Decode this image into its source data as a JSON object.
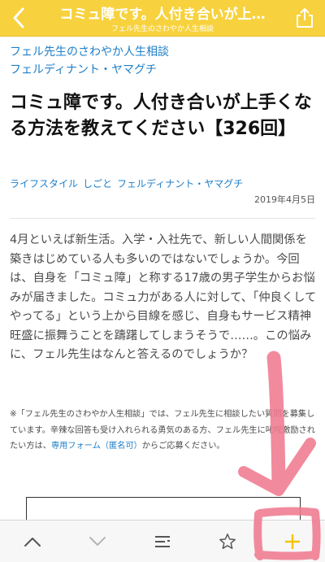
{
  "nav": {
    "title": "コミュ障です。人付き合いが上…",
    "subtitle": "フェル先生のさわやか人生相談",
    "back_icon": "chevron-left-icon",
    "share_icon": "share-icon",
    "bar_color": "#f7d23e"
  },
  "article": {
    "series_line1": "フェル先生のさわやか人生相談",
    "series_line2": "フェルディナント・ヤマグチ",
    "headline": "コミュ障です。人付き合いが上手くなる方法を教えてください【326回】",
    "tags": [
      "ライフスタイル",
      "しごと",
      "フェルディナント・ヤマグチ"
    ],
    "date": "2019年4月5日",
    "body": "4月といえば新生活。入学・入社先で、新しい人間関係を築きはじめている人も多いのではないでしょうか。今回は、自身を「コミュ障」と称する17歳の男子学生からお悩みが届きました。コミュ力がある人に対して、「仲良くしてやってる」という上から目線を感じ、自身もサービス精神旺盛に振舞うことを躊躇してしまうそうで……。この悩みに、フェル先生はなんと答えるのでしょうか？",
    "note_before": "※「フェル先生のさわやか人生相談」では、フェル先生に相談したい質問を募集しています。辛辣な回答も受け入れられる勇気のある方、フェル先生に叱咤激励されたい方は、",
    "note_link": "専用フォーム（匿名可）",
    "note_after": "からご応募ください。",
    "link_color": "#1f7fc8"
  },
  "toolbar": {
    "items": [
      {
        "icon": "chevron-up-icon"
      },
      {
        "icon": "chevron-down-icon"
      },
      {
        "icon": "list-icon"
      },
      {
        "icon": "star-icon"
      },
      {
        "icon": "plus-icon",
        "color": "#f2c300"
      }
    ]
  },
  "annotation": {
    "type": "hand-drawn arrow pointing to plus button",
    "color": "#f07a8f"
  }
}
